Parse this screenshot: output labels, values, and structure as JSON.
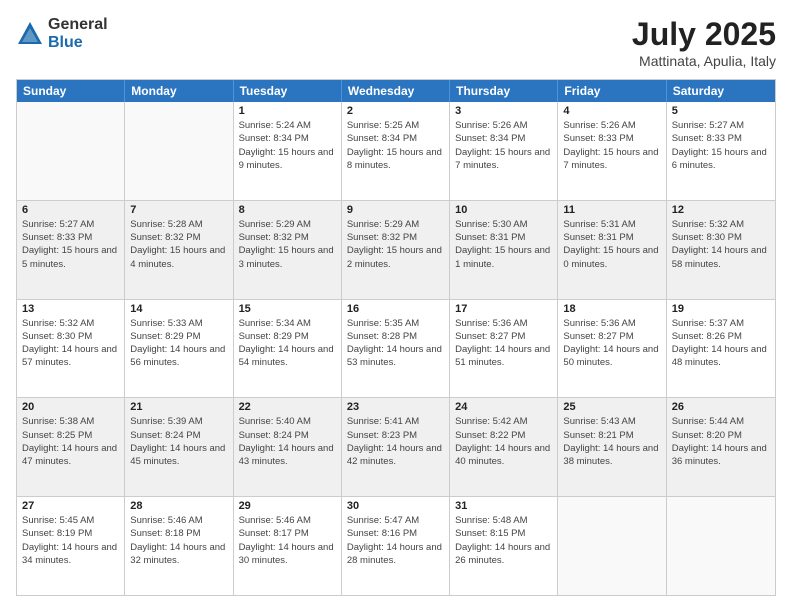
{
  "logo": {
    "general": "General",
    "blue": "Blue"
  },
  "title": "July 2025",
  "subtitle": "Mattinata, Apulia, Italy",
  "header_days": [
    "Sunday",
    "Monday",
    "Tuesday",
    "Wednesday",
    "Thursday",
    "Friday",
    "Saturday"
  ],
  "weeks": [
    [
      {
        "day": "",
        "empty": true
      },
      {
        "day": "",
        "empty": true
      },
      {
        "day": "1",
        "sunrise": "Sunrise: 5:24 AM",
        "sunset": "Sunset: 8:34 PM",
        "daylight": "Daylight: 15 hours and 9 minutes."
      },
      {
        "day": "2",
        "sunrise": "Sunrise: 5:25 AM",
        "sunset": "Sunset: 8:34 PM",
        "daylight": "Daylight: 15 hours and 8 minutes."
      },
      {
        "day": "3",
        "sunrise": "Sunrise: 5:26 AM",
        "sunset": "Sunset: 8:34 PM",
        "daylight": "Daylight: 15 hours and 7 minutes."
      },
      {
        "day": "4",
        "sunrise": "Sunrise: 5:26 AM",
        "sunset": "Sunset: 8:33 PM",
        "daylight": "Daylight: 15 hours and 7 minutes."
      },
      {
        "day": "5",
        "sunrise": "Sunrise: 5:27 AM",
        "sunset": "Sunset: 8:33 PM",
        "daylight": "Daylight: 15 hours and 6 minutes."
      }
    ],
    [
      {
        "day": "6",
        "sunrise": "Sunrise: 5:27 AM",
        "sunset": "Sunset: 8:33 PM",
        "daylight": "Daylight: 15 hours and 5 minutes."
      },
      {
        "day": "7",
        "sunrise": "Sunrise: 5:28 AM",
        "sunset": "Sunset: 8:32 PM",
        "daylight": "Daylight: 15 hours and 4 minutes."
      },
      {
        "day": "8",
        "sunrise": "Sunrise: 5:29 AM",
        "sunset": "Sunset: 8:32 PM",
        "daylight": "Daylight: 15 hours and 3 minutes."
      },
      {
        "day": "9",
        "sunrise": "Sunrise: 5:29 AM",
        "sunset": "Sunset: 8:32 PM",
        "daylight": "Daylight: 15 hours and 2 minutes."
      },
      {
        "day": "10",
        "sunrise": "Sunrise: 5:30 AM",
        "sunset": "Sunset: 8:31 PM",
        "daylight": "Daylight: 15 hours and 1 minute."
      },
      {
        "day": "11",
        "sunrise": "Sunrise: 5:31 AM",
        "sunset": "Sunset: 8:31 PM",
        "daylight": "Daylight: 15 hours and 0 minutes."
      },
      {
        "day": "12",
        "sunrise": "Sunrise: 5:32 AM",
        "sunset": "Sunset: 8:30 PM",
        "daylight": "Daylight: 14 hours and 58 minutes."
      }
    ],
    [
      {
        "day": "13",
        "sunrise": "Sunrise: 5:32 AM",
        "sunset": "Sunset: 8:30 PM",
        "daylight": "Daylight: 14 hours and 57 minutes."
      },
      {
        "day": "14",
        "sunrise": "Sunrise: 5:33 AM",
        "sunset": "Sunset: 8:29 PM",
        "daylight": "Daylight: 14 hours and 56 minutes."
      },
      {
        "day": "15",
        "sunrise": "Sunrise: 5:34 AM",
        "sunset": "Sunset: 8:29 PM",
        "daylight": "Daylight: 14 hours and 54 minutes."
      },
      {
        "day": "16",
        "sunrise": "Sunrise: 5:35 AM",
        "sunset": "Sunset: 8:28 PM",
        "daylight": "Daylight: 14 hours and 53 minutes."
      },
      {
        "day": "17",
        "sunrise": "Sunrise: 5:36 AM",
        "sunset": "Sunset: 8:27 PM",
        "daylight": "Daylight: 14 hours and 51 minutes."
      },
      {
        "day": "18",
        "sunrise": "Sunrise: 5:36 AM",
        "sunset": "Sunset: 8:27 PM",
        "daylight": "Daylight: 14 hours and 50 minutes."
      },
      {
        "day": "19",
        "sunrise": "Sunrise: 5:37 AM",
        "sunset": "Sunset: 8:26 PM",
        "daylight": "Daylight: 14 hours and 48 minutes."
      }
    ],
    [
      {
        "day": "20",
        "sunrise": "Sunrise: 5:38 AM",
        "sunset": "Sunset: 8:25 PM",
        "daylight": "Daylight: 14 hours and 47 minutes."
      },
      {
        "day": "21",
        "sunrise": "Sunrise: 5:39 AM",
        "sunset": "Sunset: 8:24 PM",
        "daylight": "Daylight: 14 hours and 45 minutes."
      },
      {
        "day": "22",
        "sunrise": "Sunrise: 5:40 AM",
        "sunset": "Sunset: 8:24 PM",
        "daylight": "Daylight: 14 hours and 43 minutes."
      },
      {
        "day": "23",
        "sunrise": "Sunrise: 5:41 AM",
        "sunset": "Sunset: 8:23 PM",
        "daylight": "Daylight: 14 hours and 42 minutes."
      },
      {
        "day": "24",
        "sunrise": "Sunrise: 5:42 AM",
        "sunset": "Sunset: 8:22 PM",
        "daylight": "Daylight: 14 hours and 40 minutes."
      },
      {
        "day": "25",
        "sunrise": "Sunrise: 5:43 AM",
        "sunset": "Sunset: 8:21 PM",
        "daylight": "Daylight: 14 hours and 38 minutes."
      },
      {
        "day": "26",
        "sunrise": "Sunrise: 5:44 AM",
        "sunset": "Sunset: 8:20 PM",
        "daylight": "Daylight: 14 hours and 36 minutes."
      }
    ],
    [
      {
        "day": "27",
        "sunrise": "Sunrise: 5:45 AM",
        "sunset": "Sunset: 8:19 PM",
        "daylight": "Daylight: 14 hours and 34 minutes."
      },
      {
        "day": "28",
        "sunrise": "Sunrise: 5:46 AM",
        "sunset": "Sunset: 8:18 PM",
        "daylight": "Daylight: 14 hours and 32 minutes."
      },
      {
        "day": "29",
        "sunrise": "Sunrise: 5:46 AM",
        "sunset": "Sunset: 8:17 PM",
        "daylight": "Daylight: 14 hours and 30 minutes."
      },
      {
        "day": "30",
        "sunrise": "Sunrise: 5:47 AM",
        "sunset": "Sunset: 8:16 PM",
        "daylight": "Daylight: 14 hours and 28 minutes."
      },
      {
        "day": "31",
        "sunrise": "Sunrise: 5:48 AM",
        "sunset": "Sunset: 8:15 PM",
        "daylight": "Daylight: 14 hours and 26 minutes."
      },
      {
        "day": "",
        "empty": true
      },
      {
        "day": "",
        "empty": true
      }
    ]
  ]
}
